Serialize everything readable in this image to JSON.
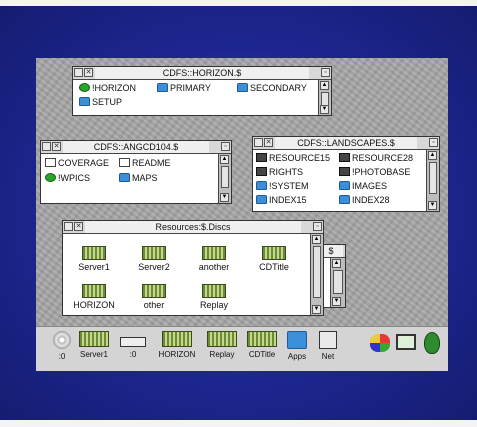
{
  "windows": {
    "horizon": {
      "title": "CDFS::HORIZON.$",
      "items": [
        "!HORIZON",
        "PRIMARY",
        "SECONDARY",
        "SETUP"
      ]
    },
    "angcd": {
      "title": "CDFS::ANGCD104.$",
      "items": [
        "COVERAGE",
        "README",
        "!WPICS",
        "MAPS"
      ]
    },
    "landscapes": {
      "title": "CDFS::LANDSCAPES.$",
      "items": [
        "RESOURCE15",
        "RESOURCE28",
        "RIGHTS",
        "!PHOTOBASE",
        "!SYSTEM",
        "IMAGES",
        "INDEX15",
        "INDEX28"
      ]
    },
    "resources": {
      "title": "Resources:$.Discs",
      "items": [
        "Server1",
        "Server2",
        "another",
        "CDTitle",
        "HORIZON",
        "other",
        "Replay"
      ]
    },
    "small": {
      "title": "$"
    }
  },
  "iconbar": {
    "items": [
      ":0",
      "Server1",
      ":0",
      "HORIZON",
      "Replay",
      "CDTitle",
      "Apps",
      "Net"
    ]
  },
  "colors": {
    "backdrop": "#1d2690",
    "desktop": "#a8a8a8",
    "folder": "#3b8fd8"
  }
}
